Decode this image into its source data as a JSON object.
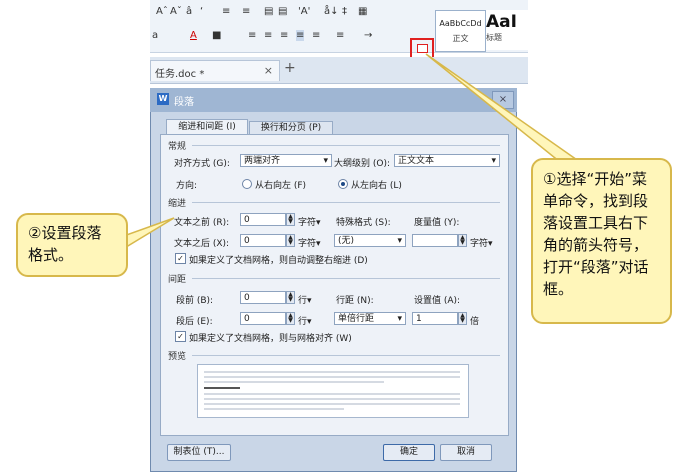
{
  "ribbon": {
    "row1": [
      "Aˆ",
      "Aˇ",
      "â",
      "‘",
      "≡",
      "≡",
      "▤",
      "▤",
      "'A'",
      "å↓",
      "‡",
      "▦"
    ],
    "row2": [
      "a",
      "A",
      "■",
      "≡",
      "≡",
      "≡",
      "≡",
      "≡",
      "≡",
      "→"
    ],
    "style1_sample": "AaBbCcDd",
    "style1_label": "正文",
    "style2_sample": "AaI",
    "style2_label": "标题"
  },
  "doc_tab": {
    "label": "任务.doc *",
    "close": "×",
    "add": "+"
  },
  "dialog": {
    "title": "段落",
    "close": "×",
    "tabs": [
      "缩进和间距 (I)",
      "换行和分页 (P)"
    ],
    "general": {
      "section": "常规",
      "align_label": "对齐方式 (G):",
      "align_value": "两端对齐",
      "outline_label": "大纲级别 (O):",
      "outline_value": "正文文本",
      "direction_label": "方向:",
      "direction_rtl": "从右向左 (F)",
      "direction_ltr": "从左向右 (L)"
    },
    "indent": {
      "section": "缩进",
      "before_label": "文本之前 (R):",
      "before_value": "0",
      "after_label": "文本之后 (X):",
      "after_value": "0",
      "unit": "字符▾",
      "special_label": "特殊格式 (S):",
      "special_value": "(无)",
      "measure_label": "度量值 (Y):",
      "measure_value": "",
      "grid_check": "如果定义了文档网格，则自动调整右缩进 (D)"
    },
    "spacing": {
      "section": "间距",
      "before_label": "段前 (B):",
      "before_value": "0",
      "after_label": "段后 (E):",
      "after_value": "0",
      "unit": "行▾",
      "line_label": "行距 (N):",
      "line_value": "单倍行距",
      "setting_label": "设置值 (A):",
      "setting_value": "1",
      "setting_unit": "倍",
      "grid_check": "如果定义了文档网格，则与网格对齐 (W)"
    },
    "preview": {
      "section": "预览"
    },
    "tabstop_button": "制表位 (T)...",
    "ok_button": "确定",
    "cancel_button": "取消"
  },
  "callouts": {
    "right": "①选择“开始”菜单命令，找到段落设置工具右下角的箭头符号，打开“段落”对话框。",
    "left": "②设置段落格式。"
  },
  "colors": {
    "highlight": "#e02020",
    "callout_fill": "#fff6ba",
    "callout_border": "#d7b84b"
  }
}
